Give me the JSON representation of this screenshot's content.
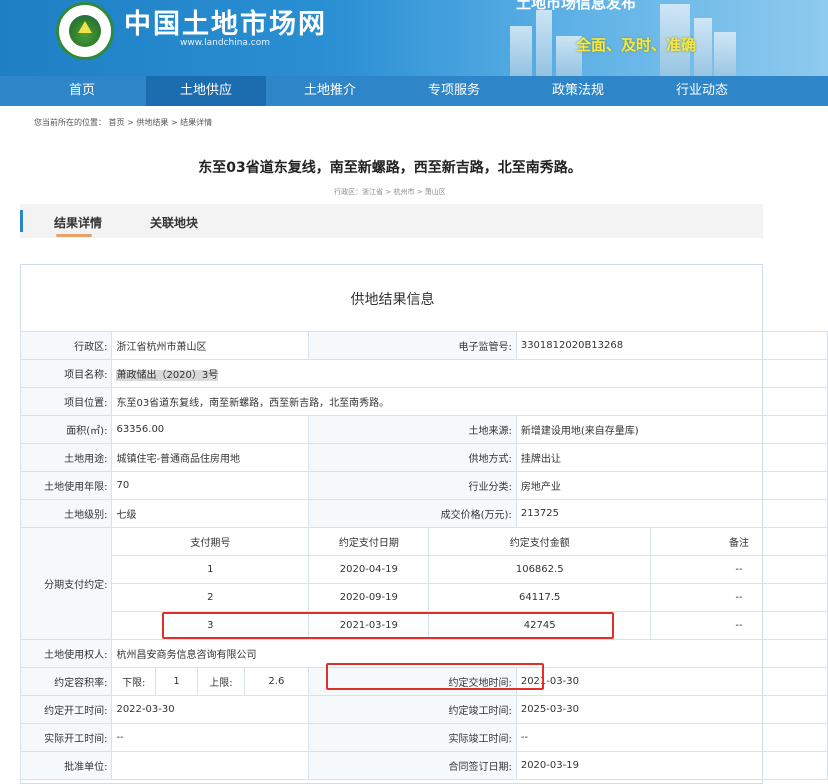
{
  "header": {
    "site_title": "中国土地市场网",
    "site_url": "www.landchina.com",
    "logo_text": "中国土地市场网 LANDCHINA",
    "banner_top": "土地市场信息发布",
    "banner_slogan": "全面、及时、准确"
  },
  "nav": {
    "items": [
      "首页",
      "土地供应",
      "土地推介",
      "专项服务",
      "政策法规",
      "行业动态"
    ],
    "active_index": 1
  },
  "breadcrumb": "您当前所在的位置： 首页 > 供地结果 > 结果详情",
  "page_title": "东至03省道东复线，南至新螺路，西至新吉路，北至南秀路。",
  "region_crumb": "行政区：浙江省 > 杭州市 > 萧山区",
  "tabs": [
    "结果详情",
    "关联地块"
  ],
  "panel_title": "供地结果信息",
  "fields": {
    "region_label": "行政区:",
    "region_value": "浙江省杭州市萧山区",
    "supervision_label": "电子监管号:",
    "supervision_value": "3301812020B13268",
    "project_name_label": "项目名称:",
    "project_name_value": "萧政储出（2020）3号",
    "location_label": "项目位置:",
    "location_value": "东至03省道东复线，南至新螺路，西至新吉路，北至南秀路。",
    "area_label": "面积(㎡):",
    "area_value": "63356.00",
    "source_label": "土地来源:",
    "source_value": "新增建设用地(来自存量库)",
    "use_label": "土地用途:",
    "use_value": "城镇住宅-普通商品住房用地",
    "supply_label": "供地方式:",
    "supply_value": "挂牌出让",
    "years_label": "土地使用年限:",
    "years_value": "70",
    "industry_label": "行业分类:",
    "industry_value": "房地产业",
    "grade_label": "土地级别:",
    "grade_value": "七级",
    "price_label": "成交价格(万元):",
    "price_value": "213725",
    "installment_label": "分期支付约定:",
    "owner_label": "土地使用权人:",
    "owner_value": "杭州昌安商务信息咨询有限公司",
    "far_label": "约定容积率:",
    "far_lower_label": "下限:",
    "far_lower_value": "1",
    "far_upper_label": "上限:",
    "far_upper_value": "2.6",
    "delivery_label": "约定交地时间:",
    "delivery_value": "2021-03-30",
    "start_label": "约定开工时间:",
    "start_value": "2022-03-30",
    "finish_label": "约定竣工时间:",
    "finish_value": "2025-03-30",
    "actual_start_label": "实际开工时间:",
    "actual_start_value": "--",
    "actual_finish_label": "实际竣工时间:",
    "actual_finish_value": "--",
    "approver_label": "批准单位:",
    "approver_value": "",
    "contract_label": "合同签订日期:",
    "contract_value": "2020-03-19"
  },
  "installments": {
    "headers": [
      "支付期号",
      "约定支付日期",
      "约定支付金额",
      "备注"
    ],
    "rows": [
      [
        "1",
        "2020-04-19",
        "106862.5",
        "--"
      ],
      [
        "2",
        "2020-09-19",
        "64117.5",
        "--"
      ],
      [
        "3",
        "2021-03-19",
        "42745",
        "--"
      ]
    ]
  },
  "colors": {
    "nav": "#2e86c9",
    "nav_active": "#1c6db0",
    "highlight_box": "#e0302b"
  }
}
